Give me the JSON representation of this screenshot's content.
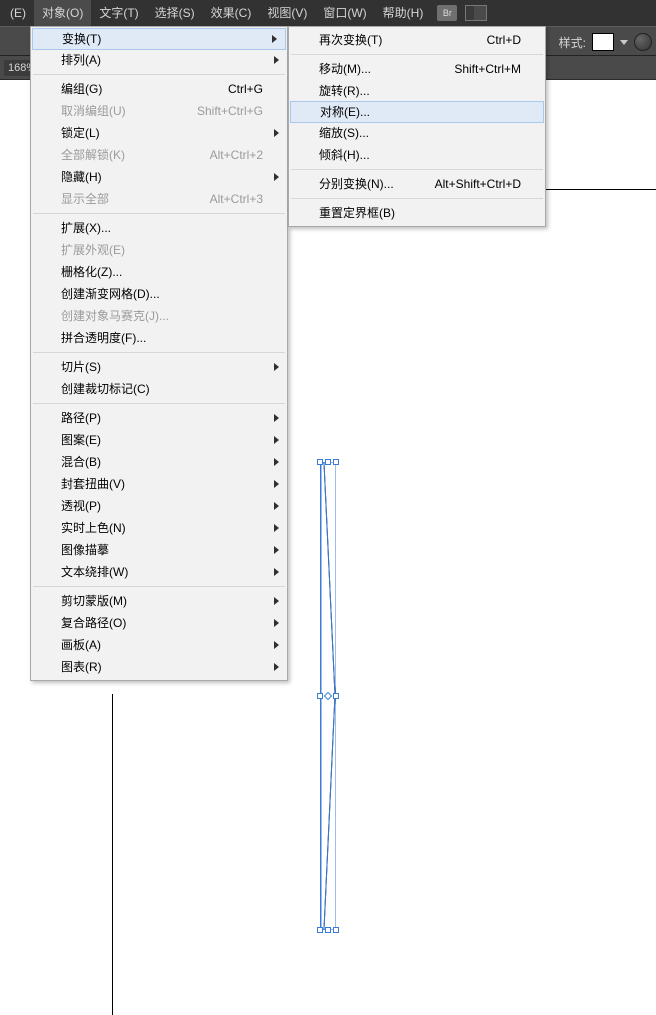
{
  "topbar": {
    "items": [
      {
        "label": "(E)"
      },
      {
        "label": "对象(O)"
      },
      {
        "label": "文字(T)"
      },
      {
        "label": "选择(S)"
      },
      {
        "label": "效果(C)"
      },
      {
        "label": "视图(V)"
      },
      {
        "label": "窗口(W)"
      },
      {
        "label": "帮助(H)"
      }
    ],
    "br": "Br"
  },
  "toolbar": {
    "style_label": "样式:"
  },
  "secondbar": {
    "zoom": "168%"
  },
  "main_menu": [
    {
      "label": "变换(T)",
      "sub": true,
      "highlight": true
    },
    {
      "label": "排列(A)",
      "sub": true
    },
    {
      "sep": true
    },
    {
      "label": "编组(G)",
      "shortcut": "Ctrl+G"
    },
    {
      "label": "取消编组(U)",
      "shortcut": "Shift+Ctrl+G",
      "disabled": true
    },
    {
      "label": "锁定(L)",
      "sub": true
    },
    {
      "label": "全部解锁(K)",
      "shortcut": "Alt+Ctrl+2",
      "disabled": true
    },
    {
      "label": "隐藏(H)",
      "sub": true
    },
    {
      "label": "显示全部",
      "shortcut": "Alt+Ctrl+3",
      "disabled": true
    },
    {
      "sep": true
    },
    {
      "label": "扩展(X)..."
    },
    {
      "label": "扩展外观(E)",
      "disabled": true
    },
    {
      "label": "栅格化(Z)..."
    },
    {
      "label": "创建渐变网格(D)..."
    },
    {
      "label": "创建对象马赛克(J)...",
      "disabled": true
    },
    {
      "label": "拼合透明度(F)..."
    },
    {
      "sep": true
    },
    {
      "label": "切片(S)",
      "sub": true
    },
    {
      "label": "创建裁切标记(C)"
    },
    {
      "sep": true
    },
    {
      "label": "路径(P)",
      "sub": true
    },
    {
      "label": "图案(E)",
      "sub": true
    },
    {
      "label": "混合(B)",
      "sub": true
    },
    {
      "label": "封套扭曲(V)",
      "sub": true
    },
    {
      "label": "透视(P)",
      "sub": true
    },
    {
      "label": "实时上色(N)",
      "sub": true
    },
    {
      "label": "图像描摹",
      "sub": true
    },
    {
      "label": "文本绕排(W)",
      "sub": true
    },
    {
      "sep": true
    },
    {
      "label": "剪切蒙版(M)",
      "sub": true
    },
    {
      "label": "复合路径(O)",
      "sub": true
    },
    {
      "label": "画板(A)",
      "sub": true
    },
    {
      "label": "图表(R)",
      "sub": true
    }
  ],
  "sub_menu": [
    {
      "label": "再次变换(T)",
      "shortcut": "Ctrl+D"
    },
    {
      "sep": true
    },
    {
      "label": "移动(M)...",
      "shortcut": "Shift+Ctrl+M"
    },
    {
      "label": "旋转(R)..."
    },
    {
      "label": "对称(E)...",
      "highlight": true
    },
    {
      "label": "缩放(S)..."
    },
    {
      "label": "倾斜(H)..."
    },
    {
      "sep": true
    },
    {
      "label": "分别变换(N)...",
      "shortcut": "Alt+Shift+Ctrl+D"
    },
    {
      "sep": true
    },
    {
      "label": "重置定界框(B)"
    }
  ]
}
